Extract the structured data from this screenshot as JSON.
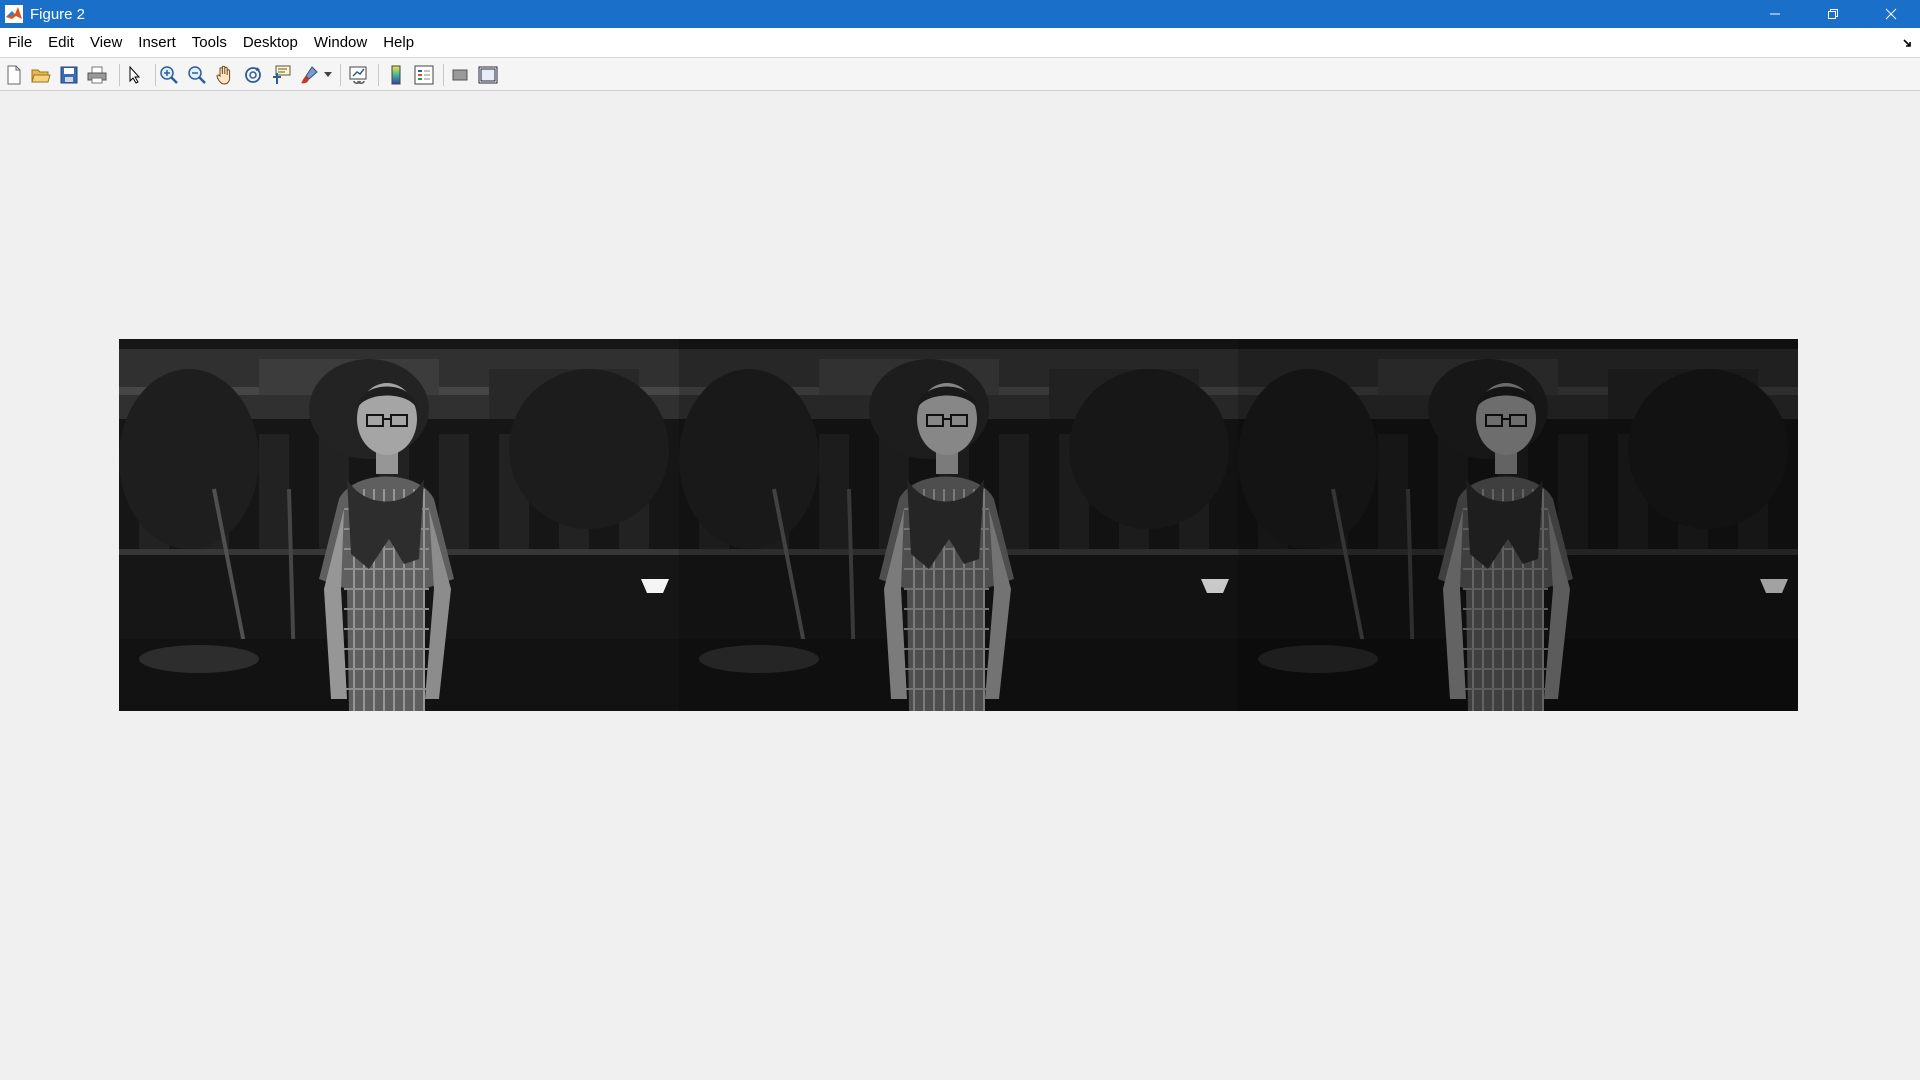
{
  "window": {
    "title": "Figure 2",
    "controls": [
      "minimize-icon",
      "restore-icon",
      "close-icon"
    ]
  },
  "menubar": {
    "items": [
      {
        "label": "File"
      },
      {
        "label": "Edit"
      },
      {
        "label": "View"
      },
      {
        "label": "Insert"
      },
      {
        "label": "Tools"
      },
      {
        "label": "Desktop"
      },
      {
        "label": "Window"
      },
      {
        "label": "Help"
      }
    ]
  },
  "toolbar": {
    "icons": [
      "new-figure-icon",
      "open-file-icon",
      "save-figure-icon",
      "print-figure-icon",
      "edit-plot-arrow-icon",
      "zoom-in-icon",
      "zoom-out-icon",
      "pan-hand-icon",
      "rotate-3d-icon",
      "data-cursor-icon",
      "brush-icon",
      "link-plot-icon",
      "insert-colorbar-icon",
      "insert-legend-icon",
      "hide-plot-tools-icon",
      "show-plot-tools-icon"
    ]
  },
  "figure": {
    "panels": [
      {
        "brightness": 1.0
      },
      {
        "brightness": 0.82
      },
      {
        "brightness": 0.66
      }
    ]
  }
}
